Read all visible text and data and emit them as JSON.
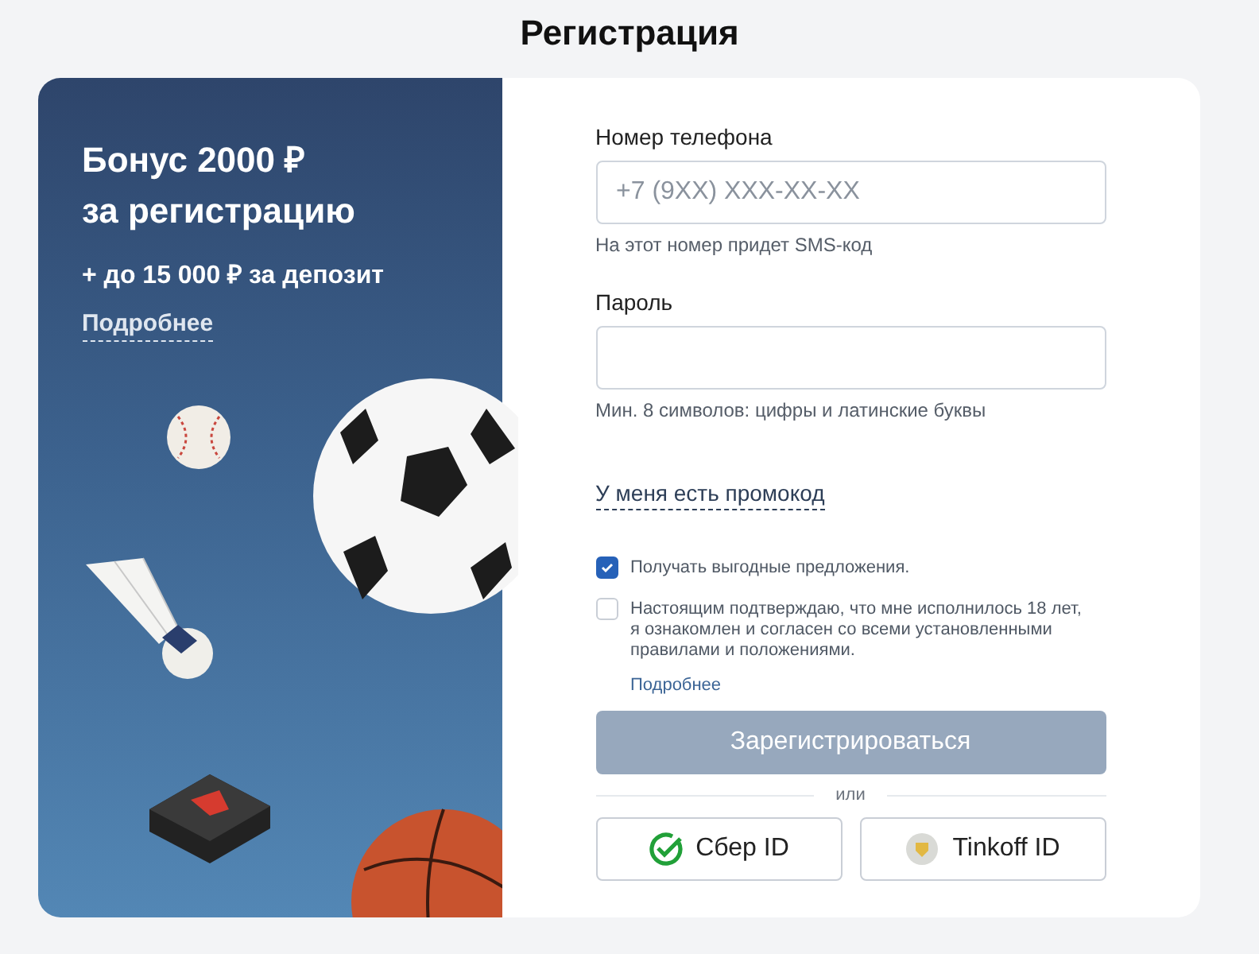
{
  "title": "Регистрация",
  "promo": {
    "heading_line1": "Бонус 2000 ₽",
    "heading_line2": "за регистрацию",
    "subheading": "+ до 15 000 ₽ за депозит",
    "link": "Подробнее"
  },
  "form": {
    "fields": [
      {
        "label": "Номер телефона",
        "placeholder": "+7 (9XX) XXX-XX-XX",
        "hint": "На этот номер придет SMS-код"
      },
      {
        "label": "Пароль",
        "hint": "Мин. 8 символов: цифры и латинские буквы"
      }
    ],
    "promocode_link": "У меня есть промокод",
    "checkboxes": [
      {
        "label": "Получать выгодные предложения.",
        "checked": true
      },
      {
        "label": "Настоящим подтверждаю, что мне исполнилось 18 лет, я ознакомлен и согласен со всеми установленными правилами и положениями.",
        "checked": false,
        "link": "Подробнее"
      }
    ],
    "submit": {
      "label": "Зарегистрироваться",
      "disabled": true
    },
    "divider": "или",
    "id_buttons": [
      {
        "kind": "sber",
        "label": "Сбер ID"
      },
      {
        "kind": "tinkoff",
        "label": "Tinkoff ID"
      }
    ]
  }
}
